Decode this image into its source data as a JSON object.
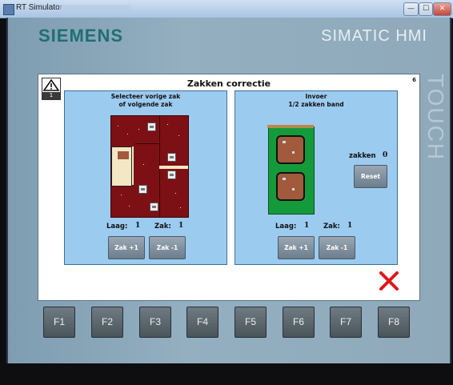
{
  "window": {
    "title": "RT Simulator",
    "minimize": "—",
    "maximize": "☐",
    "close": "✕"
  },
  "brand": "SIEMENS",
  "product": "SIMATIC HMI",
  "side_label": "TOUCH",
  "screen": {
    "title": "Zakken correctie",
    "number": "6",
    "alarm_count": "1",
    "left": {
      "title_line1": "Selecteer vorige zak",
      "title_line2": "of volgende zak",
      "laag_label": "Laag:",
      "laag_value": "1",
      "zak_label": "Zak:",
      "zak_value": "1",
      "btn_next": "Zak +1",
      "btn_prev": "Zak -1"
    },
    "right": {
      "title_line1": "Invoer",
      "title_line2": "1/2 zakken band",
      "zakken_label": "zakken",
      "zakken_value": "0",
      "reset": "Reset",
      "laag_label": "Laag:",
      "laag_value": "1",
      "zak_label": "Zak:",
      "zak_value": "1",
      "btn_next": "Zak +1",
      "btn_prev": "Zak -1"
    }
  },
  "function_keys": [
    "F1",
    "F2",
    "F3",
    "F4",
    "F5",
    "F6",
    "F7",
    "F8"
  ],
  "colors": {
    "panel": "#8fa9ba",
    "subpanel": "#9ccbf0",
    "pallet": "#7d1014",
    "band": "#159a3b",
    "bag": "#a25a3d",
    "brand": "#1e6f73",
    "close_x": "#e0161b"
  },
  "icons": [
    "warning-icon",
    "close-icon",
    "app-icon"
  ]
}
